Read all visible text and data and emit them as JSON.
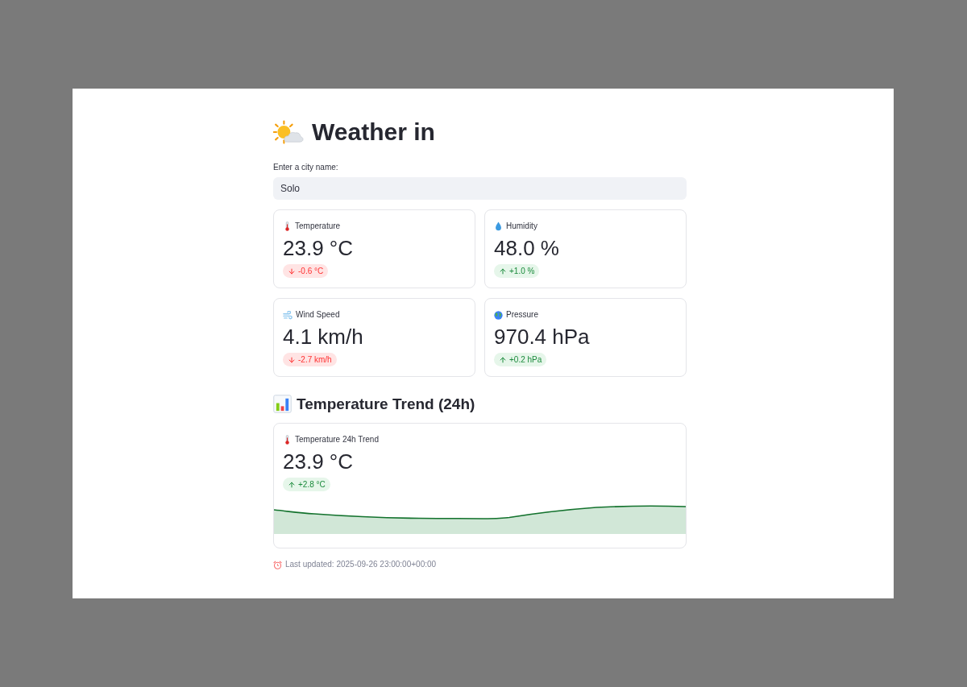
{
  "title": "Weather in",
  "city_input": {
    "label": "Enter a city name:",
    "value": "Solo"
  },
  "metrics": [
    {
      "kind": "temperature",
      "label": "Temperature",
      "value": "23.9 °C",
      "delta": "-0.6 °C",
      "rising": false
    },
    {
      "kind": "humidity",
      "label": "Humidity",
      "value": "48.0 %",
      "delta": "+1.0 %",
      "rising": true
    },
    {
      "kind": "wind",
      "label": "Wind Speed",
      "value": "4.1 km/h",
      "delta": "-2.7 km/h",
      "rising": false
    },
    {
      "kind": "pressure",
      "label": "Pressure",
      "value": "970.4 hPa",
      "delta": "+0.2 hPa",
      "rising": true
    }
  ],
  "trend": {
    "heading": "Temperature Trend (24h)",
    "card": {
      "kind": "temperature",
      "label": "Temperature 24h Trend",
      "value": "23.9 °C",
      "delta": "+2.8 °C",
      "rising": true
    }
  },
  "last_updated": "Last updated: 2025-09-26 23:00:00+00:00"
}
